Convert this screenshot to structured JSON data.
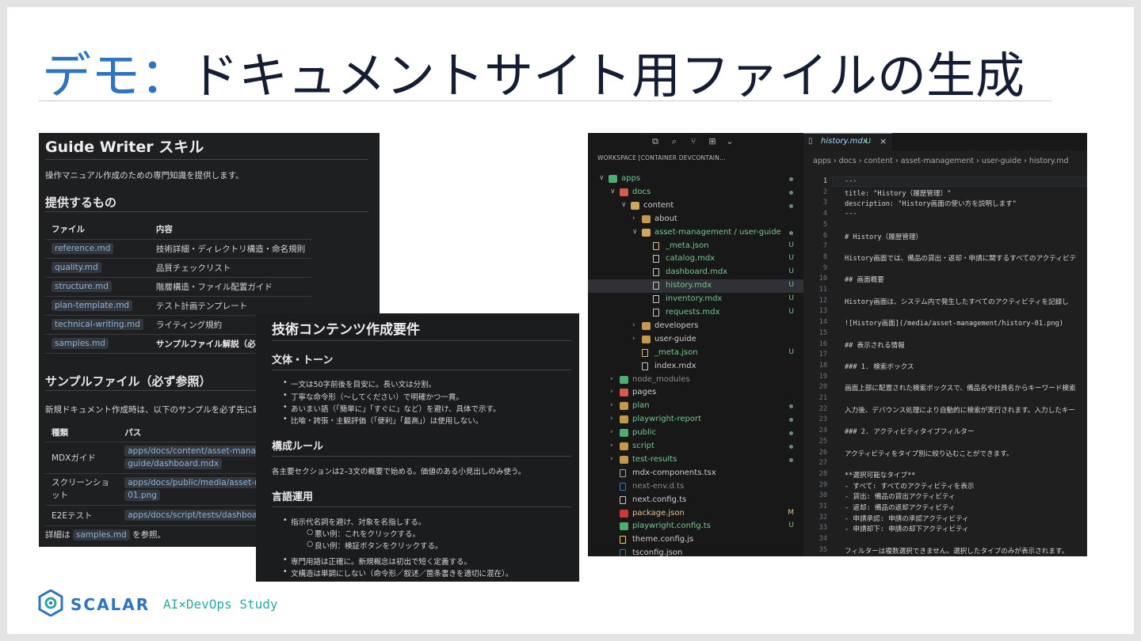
{
  "slide": {
    "title_accent": "デモ：",
    "title_main": "ドキュメントサイト用ファイルの生成"
  },
  "panel1": {
    "heading": "Guide Writer スキル",
    "intro": "操作マニュアル作成のための専門知識を提供します。",
    "section1": "提供するもの",
    "table1": {
      "headers": [
        "ファイル",
        "内容"
      ],
      "rows": [
        [
          "reference.md",
          "技術詳細・ディレクトリ構造・命名規則"
        ],
        [
          "quality.md",
          "品質チェックリスト"
        ],
        [
          "structure.md",
          "階層構造・ファイル配置ガイド"
        ],
        [
          "plan-template.md",
          "テスト計画テンプレート"
        ],
        [
          "technical-writing.md",
          "ライティング規約"
        ],
        [
          "samples.md",
          "サンプルファイル解説（必読）"
        ]
      ]
    },
    "section2": "サンプルファイル（必ず参照）",
    "sample_intro": "新規ドキュメント作成時は、以下のサンプルを必ず先に確認",
    "table2": {
      "headers": [
        "種類",
        "パス"
      ],
      "rows": [
        [
          "MDXガイド",
          "apps/docs/content/asset-manage",
          "guide/dashboard.mdx"
        ],
        [
          "スクリーンショ",
          "apps/docs/public/media/asset-ma",
          "ット",
          "01.png"
        ],
        [
          "E2Eテスト",
          "apps/docs/script/tests/dashboard"
        ]
      ]
    },
    "footer_pre": "詳細は",
    "footer_code": "samples.md",
    "footer_post": "を参照。"
  },
  "panel2": {
    "heading": "技術コンテンツ作成要件",
    "section1": "文体・トーン",
    "s1_items": [
      "一文は50字前後を目安に。長い文は分割。",
      "丁寧な命令形（〜してください）で明確かつ一貫。",
      "あいまい語（「簡単に」「すぐに」など）を避け、具体で示す。",
      "比喩・誇張・主観評価（「便利」「最高」）は使用しない。"
    ],
    "section2": "構成ルール",
    "s2_text": "各主要セクションは2–3文の概要で始める。価値のある小見出しのみ使う。",
    "section3": "言語運用",
    "s3_item1": "指示代名詞を避け、対象を名指しする。",
    "s3_sub": [
      "悪い例：これをクリックする。",
      "良い例：検証ボタンをクリックする。"
    ],
    "s3_items": [
      "専門用語は正確に。新規概念は初出で短く定義する。",
      "文構造は単調にしない（命令形／叙述／箇条書きを適切に混在）。"
    ]
  },
  "editor": {
    "workspace": "WORKSPACE [CONTAINER DEVCONTAIN...",
    "tree": [
      {
        "label": "apps",
        "status": "dot"
      },
      {
        "label": "docs",
        "status": "dot"
      },
      {
        "label": "content",
        "status": "dot"
      },
      {
        "label": "about",
        "status": ""
      },
      {
        "label": "asset-management / user-guide",
        "status": "dot"
      },
      {
        "label": "_meta.json",
        "status": "U"
      },
      {
        "label": "catalog.mdx",
        "status": "U"
      },
      {
        "label": "dashboard.mdx",
        "status": "U"
      },
      {
        "label": "history.mdx",
        "status": "U"
      },
      {
        "label": "inventory.mdx",
        "status": "U"
      },
      {
        "label": "requests.mdx",
        "status": "U"
      },
      {
        "label": "developers",
        "status": ""
      },
      {
        "label": "user-guide",
        "status": ""
      },
      {
        "label": "_meta.json",
        "status": "U"
      },
      {
        "label": "index.mdx",
        "status": ""
      },
      {
        "label": "node_modules",
        "status": ""
      },
      {
        "label": "pages",
        "status": ""
      },
      {
        "label": "plan",
        "status": "dot"
      },
      {
        "label": "playwright-report",
        "status": "dot"
      },
      {
        "label": "public",
        "status": "dot"
      },
      {
        "label": "script",
        "status": "dot"
      },
      {
        "label": "test-results",
        "status": "dot"
      },
      {
        "label": "mdx-components.tsx",
        "status": ""
      },
      {
        "label": "next-env.d.ts",
        "status": ""
      },
      {
        "label": "next.config.ts",
        "status": ""
      },
      {
        "label": "package.json",
        "status": "M"
      },
      {
        "label": "playwright.config.ts",
        "status": "U"
      },
      {
        "label": "theme.config.js",
        "status": ""
      },
      {
        "label": "tsconfig.json",
        "status": ""
      }
    ],
    "tab_title": "history.mdx",
    "tab_status": "U",
    "breadcrumb": "apps › docs › content › asset-management › user-guide › history.md",
    "code_lines": [
      [
        "1",
        "---"
      ],
      [
        "2",
        "title: \"History（履歴管理）\""
      ],
      [
        "3",
        "description: \"History画面の使い方を説明します\""
      ],
      [
        "4",
        "---"
      ],
      [
        "5",
        ""
      ],
      [
        "6",
        "# History（履歴管理）"
      ],
      [
        "7",
        ""
      ],
      [
        "8",
        "History画面では、備品の貸出・返却・申請に関するすべてのアクティビテ"
      ],
      [
        "9",
        ""
      ],
      [
        "10",
        "## 画面概要"
      ],
      [
        "11",
        ""
      ],
      [
        "12",
        "History画面は、システム内で発生したすべてのアクティビティを記録し"
      ],
      [
        "13",
        ""
      ],
      [
        "14",
        "![History画面](/media/asset-management/history-01.png)"
      ],
      [
        "15",
        ""
      ],
      [
        "16",
        "## 表示される情報"
      ],
      [
        "17",
        ""
      ],
      [
        "18",
        "### 1. 検索ボックス"
      ],
      [
        "19",
        ""
      ],
      [
        "20",
        "画面上部に配置された検索ボックスで、備品名や社員名からキーワード検索"
      ],
      [
        "21",
        ""
      ],
      [
        "22",
        "入力後、デバウンス処理により自動的に検索が実行されます。入力したキー"
      ],
      [
        "23",
        ""
      ],
      [
        "24",
        "### 2. アクティビティタイプフィルター"
      ],
      [
        "25",
        ""
      ],
      [
        "26",
        "アクティビティをタイプ別に絞り込むことができます。"
      ],
      [
        "27",
        ""
      ],
      [
        "28",
        "**選択可能なタイプ**"
      ],
      [
        "29",
        "- すべて: すべてのアクティビティを表示"
      ],
      [
        "30",
        "- 貸出: 備品の貸出アクティビティ"
      ],
      [
        "31",
        "- 返却: 備品の返却アクティビティ"
      ],
      [
        "32",
        "- 申請承認: 申請の承認アクティビティ"
      ],
      [
        "33",
        "- 申請却下: 申請の却下アクティビティ"
      ],
      [
        "34",
        ""
      ],
      [
        "35",
        "フィルターは複数選択できません。選択したタイプのみが表示されます。"
      ]
    ]
  },
  "footer": {
    "brand": "SCALAR",
    "study": "AI×DevOps Study"
  }
}
